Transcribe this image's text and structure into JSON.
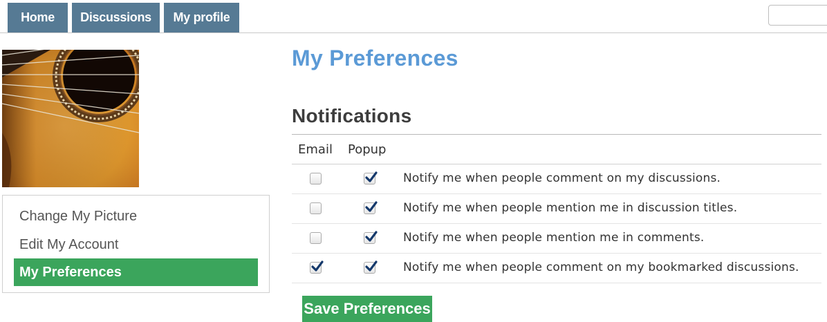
{
  "nav": {
    "tabs": [
      {
        "label": "Home"
      },
      {
        "label": "Discussions"
      },
      {
        "label": "My profile"
      }
    ],
    "search": {
      "value": "",
      "placeholder": ""
    }
  },
  "sidebar": {
    "menu": [
      {
        "label": "Change My Picture",
        "active": false
      },
      {
        "label": "Edit My Account",
        "active": false
      },
      {
        "label": "My Preferences",
        "active": true
      }
    ]
  },
  "main": {
    "title": "My Preferences",
    "section": "Notifications",
    "columns": {
      "email": "Email",
      "popup": "Popup"
    },
    "rows": [
      {
        "label": "Notify me when people comment on my discussions.",
        "email": false,
        "popup": true
      },
      {
        "label": "Notify me when people mention me in discussion titles.",
        "email": false,
        "popup": true
      },
      {
        "label": "Notify me when people mention me in comments.",
        "email": false,
        "popup": true
      },
      {
        "label": "Notify me when people comment on my bookmarked discussions.",
        "email": true,
        "popup": true
      }
    ],
    "save_label": "Save Preferences"
  },
  "colors": {
    "nav_tab": "#567a94",
    "accent_green": "#3ba55c",
    "title_blue": "#5b9ad6",
    "check_navy": "#14386b"
  },
  "icons": {
    "profile_photo": "guitar-photo",
    "checked": "checkmark-icon"
  }
}
